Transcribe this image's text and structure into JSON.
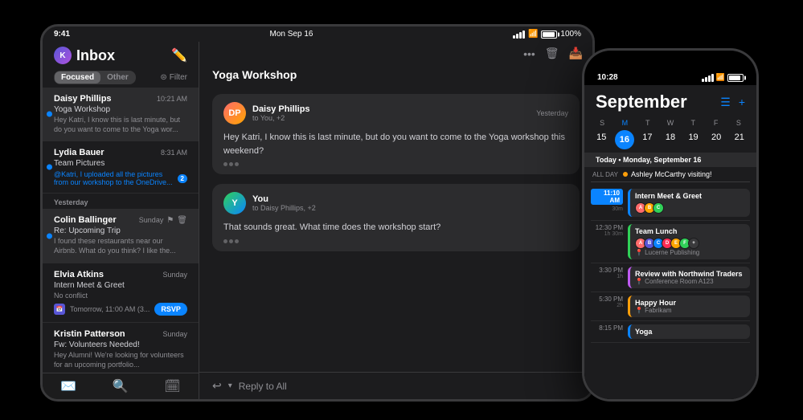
{
  "scene": {
    "background": "#000"
  },
  "tablet": {
    "statusBar": {
      "time": "9:41",
      "date": "Mon Sep 16",
      "signal": "●●●",
      "wifi": "WiFi",
      "battery": "100%"
    },
    "inbox": {
      "title": "Inbox",
      "tabs": [
        "Focused",
        "Other"
      ],
      "activeTab": "Focused",
      "filterLabel": "Filter",
      "items": [
        {
          "sender": "Daisy Phillips",
          "time": "10:21 AM",
          "subject": "Yoga Workshop",
          "preview": "Hey Katri, I know this is last minute, but do you want to come to the Yoga wor...",
          "unread": true,
          "selected": true
        },
        {
          "sender": "Lydia Bauer",
          "time": "8:31 AM",
          "subject": "Team Pictures",
          "preview": "@Katri, I uploaded all the pictures from our workshop to the OneDrive...",
          "unread": true,
          "hasMention": true,
          "mentionCount": "2"
        },
        {
          "sectionLabel": "Yesterday"
        },
        {
          "sender": "Colin Ballinger",
          "time": "Sunday",
          "subject": "Re: Upcoming Trip",
          "preview": "I found these restaurants near our Airbnb. What do you think? I like the...",
          "unread": true,
          "hasActions": true
        },
        {
          "sender": "Elvia Atkins",
          "time": "Sunday",
          "subject": "Intern Meet & Greet",
          "preview": "No conflict",
          "hasRsvp": true,
          "rsvpLabel": "RSVP",
          "calendarInfo": "Tomorrow, 11:00 AM (3..."
        },
        {
          "sender": "Kristin Patterson",
          "time": "Sunday",
          "subject": "Fw: Volunteers Needed!",
          "preview": "Hey Alumni! We're looking for volunteers for an upcoming portfolio..."
        }
      ]
    },
    "emailDetail": {
      "subject": "Yoga Workshop",
      "messages": [
        {
          "sender": "Daisy Phillips",
          "avatar": "DP",
          "recipients": "to You, +2",
          "date": "Yesterday",
          "body": "Hey Katri, I know this is last minute, but do you want to come to the Yoga workshop this weekend?",
          "isYou": false
        },
        {
          "sender": "You",
          "avatar": "Y",
          "recipients": "to Daisy Phillips, +2",
          "date": "",
          "body": "That sounds great. What time does the workshop start?",
          "isYou": true
        }
      ],
      "replyLabel": "Reply to All"
    },
    "tabBar": [
      {
        "icon": "✉️",
        "label": "",
        "active": true
      },
      {
        "icon": "🔍",
        "label": "",
        "active": false
      },
      {
        "icon": "🗓",
        "label": "",
        "active": false
      }
    ]
  },
  "phone": {
    "statusBar": {
      "time": "10:28",
      "signal": "●●●",
      "wifi": "▲",
      "battery": "■"
    },
    "calendar": {
      "month": "September",
      "headerIcons": [
        "☰",
        "+"
      ],
      "dayHeaders": [
        "S",
        "M",
        "T",
        "W",
        "T",
        "F",
        "S"
      ],
      "days": [
        "15",
        "16",
        "17",
        "18",
        "19",
        "20",
        "21"
      ],
      "todayIndex": 1,
      "todayLabel": "Today • Monday, September 16",
      "allDayEvent": "Ashley McCarthy visiting!",
      "events": [
        {
          "time": "11:00 AM",
          "duration": "30m",
          "title": "Intern Meet & Greet",
          "color": "blue",
          "hasAvatars": true
        },
        {
          "time": "12:30 PM",
          "duration": "1h 30m",
          "title": "Team Lunch",
          "location": "Lucerne Publishing",
          "color": "green",
          "hasAvatars": true
        },
        {
          "time": "3:30 PM",
          "duration": "1h",
          "title": "Review with Northwind Traders",
          "location": "Conference Room A123",
          "color": "purple"
        },
        {
          "time": "5:30 PM",
          "duration": "2h",
          "title": "Happy Hour",
          "location": "Fabrikam",
          "color": "orange"
        },
        {
          "time": "8:15 PM",
          "duration": "",
          "title": "Yoga",
          "color": "blue"
        }
      ]
    }
  }
}
